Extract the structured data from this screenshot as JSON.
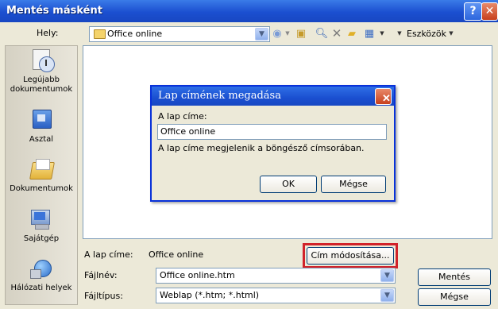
{
  "window": {
    "title": "Mentés másként"
  },
  "toolbar": {
    "location_label": "Hely:",
    "location_value": "Office online",
    "tools_label": "Eszközök"
  },
  "places": [
    {
      "label": "Legújabb dokumentumok",
      "icon": "recent-documents-icon"
    },
    {
      "label": "Asztal",
      "icon": "desktop-icon"
    },
    {
      "label": "Dokumentumok",
      "icon": "my-documents-icon"
    },
    {
      "label": "Sajátgép",
      "icon": "my-computer-icon"
    },
    {
      "label": "Hálózati helyek",
      "icon": "network-places-icon"
    }
  ],
  "bottom": {
    "page_title_label": "A lap címe:",
    "page_title_value": "Office online",
    "change_title_button": "Cím módosítása...",
    "filename_label": "Fájlnév:",
    "filename_value": "Office online.htm",
    "filetype_label": "Fájltípus:",
    "filetype_value": "Weblap (*.htm; *.html)",
    "save_button": "Mentés",
    "cancel_button": "Mégse"
  },
  "dialog": {
    "title": "Lap címének megadása",
    "field_label": "A lap címe:",
    "field_value": "Office online",
    "info_text": "A lap címe megjelenik a böngésző címsorában.",
    "ok_button": "OK",
    "cancel_button": "Mégse"
  },
  "colors": {
    "titlebar": "#1b4fd0",
    "highlight": "#d1232a"
  }
}
